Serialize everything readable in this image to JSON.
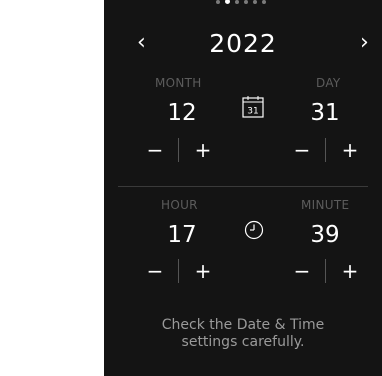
{
  "pager": {
    "count": 6,
    "active_index": 1
  },
  "year_nav": {
    "prev": "‹",
    "year": "2022",
    "next": "›"
  },
  "date": {
    "month_label": "MONTH",
    "month_value": "12",
    "day_label": "DAY",
    "day_value": "31",
    "calendar_icon_text": "31"
  },
  "time": {
    "hour_label": "HOUR",
    "hour_value": "17",
    "minute_label": "MINUTE",
    "minute_value": "39"
  },
  "stepper": {
    "minus": "−",
    "plus": "+"
  },
  "hint": {
    "line1": "Check the Date & Time",
    "line2": "settings carefully."
  },
  "colors": {
    "background": "#141414",
    "text": "#ffffff",
    "label": "#5c5c5c",
    "hint": "#9a9a9a"
  }
}
